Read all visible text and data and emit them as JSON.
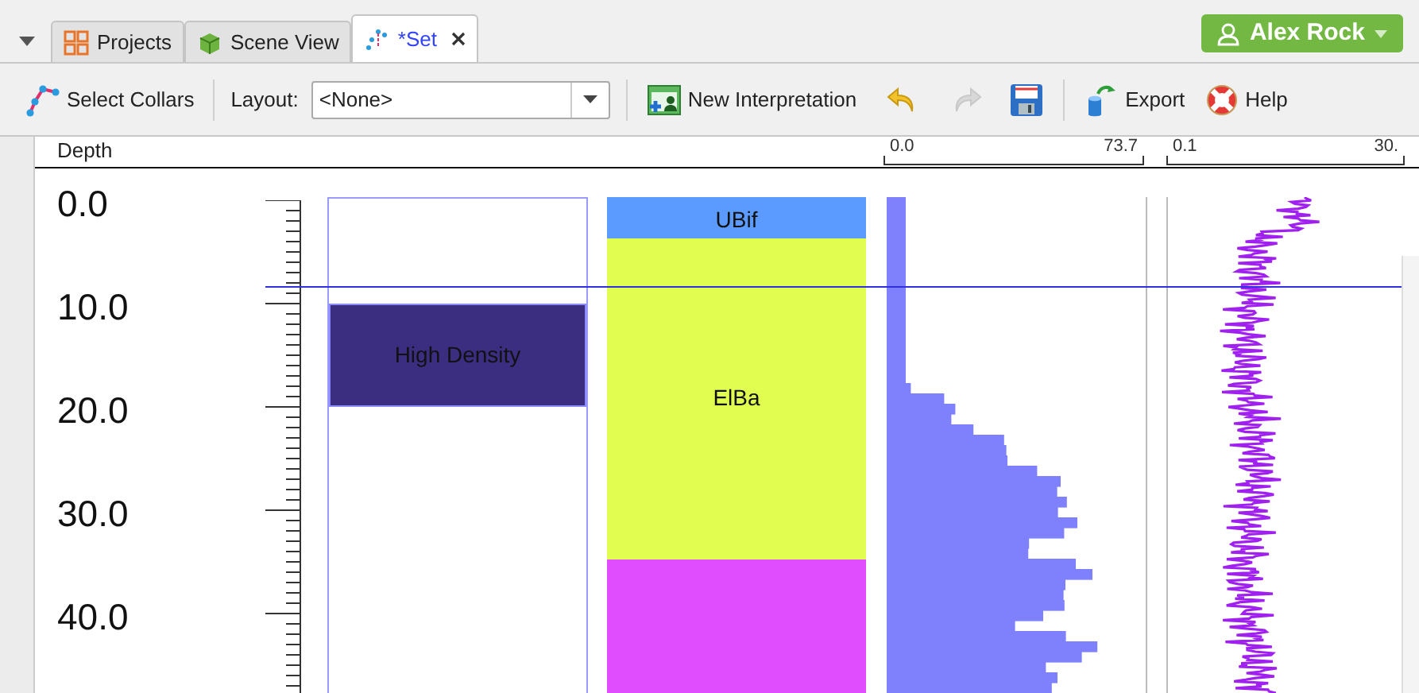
{
  "tabs": [
    {
      "label": "Projects",
      "kind": "projects",
      "selected": false,
      "closable": false
    },
    {
      "label": "Scene View",
      "kind": "scene",
      "selected": false,
      "closable": false
    },
    {
      "label": "*Set",
      "kind": "set",
      "selected": true,
      "closable": true
    }
  ],
  "user": {
    "name": "Alex Rock"
  },
  "toolbar": {
    "select_collars": "Select Collars",
    "layout_label": "Layout:",
    "layout_value": "<None>",
    "new_interpretation": "New Interpretation",
    "undo": {
      "disabled": false
    },
    "redo": {
      "disabled": true
    },
    "export": "Export",
    "help": "Help"
  },
  "header": {
    "depth_title": "Depth",
    "scale_1": [
      "0.0",
      "73.7"
    ],
    "scale_2": [
      "0.1",
      "30."
    ]
  },
  "depth_labels": [
    "0.0",
    "10.0",
    "20.0",
    "30.0",
    "40.0"
  ],
  "intervals": [
    {
      "label": "High Density",
      "color": "#3b2e80"
    }
  ],
  "lithology": [
    {
      "label": "UBif",
      "color": "#5b9bff"
    },
    {
      "label": "ElBa",
      "color": "#e1fd4f"
    },
    {
      "color": "#e04dff"
    }
  ]
}
